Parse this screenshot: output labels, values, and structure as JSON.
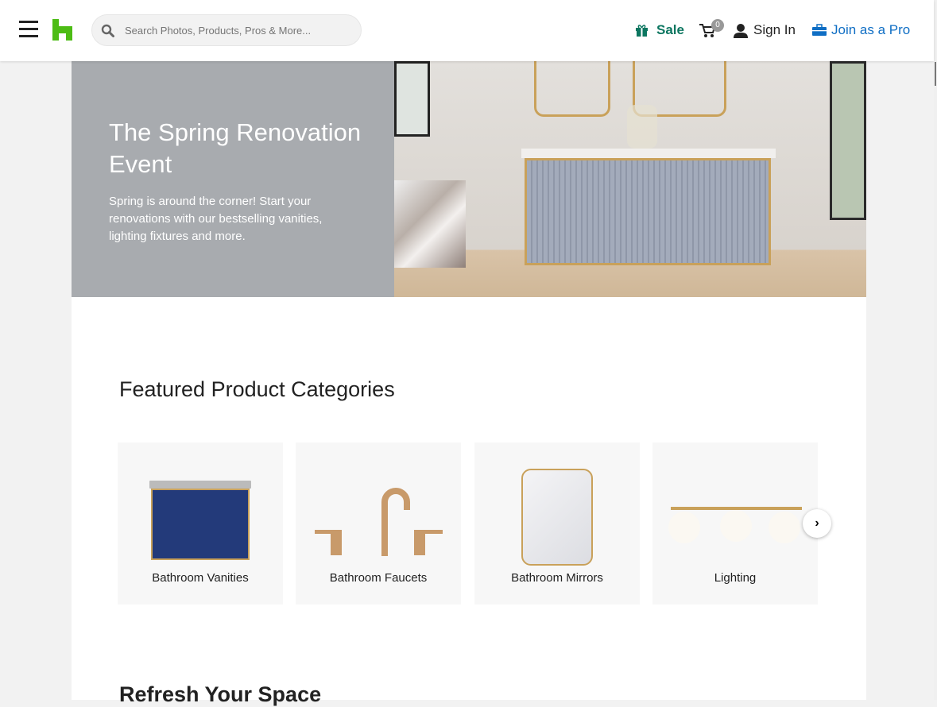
{
  "header": {
    "search_placeholder": "Search Photos, Products, Pros & More...",
    "sale": "Sale",
    "cart_count": "0",
    "sign_in": "Sign In",
    "join_pro": "Join as a Pro"
  },
  "hero": {
    "title": "The Spring Renovation Event",
    "text": "Spring is around the corner! Start your renovations with our bestselling vanities, lighting fixtures and more."
  },
  "featured": {
    "title": "Featured Product Categories",
    "categories": [
      {
        "label": "Bathroom Vanities"
      },
      {
        "label": "Bathroom Faucets"
      },
      {
        "label": "Bathroom Mirrors"
      },
      {
        "label": "Lighting"
      }
    ],
    "next_icon": "›"
  },
  "next_section": {
    "title": "Refresh Your Space"
  },
  "colors": {
    "brand": "#4dbc15",
    "sale": "#0c7660",
    "pro": "#0f6ec4"
  }
}
